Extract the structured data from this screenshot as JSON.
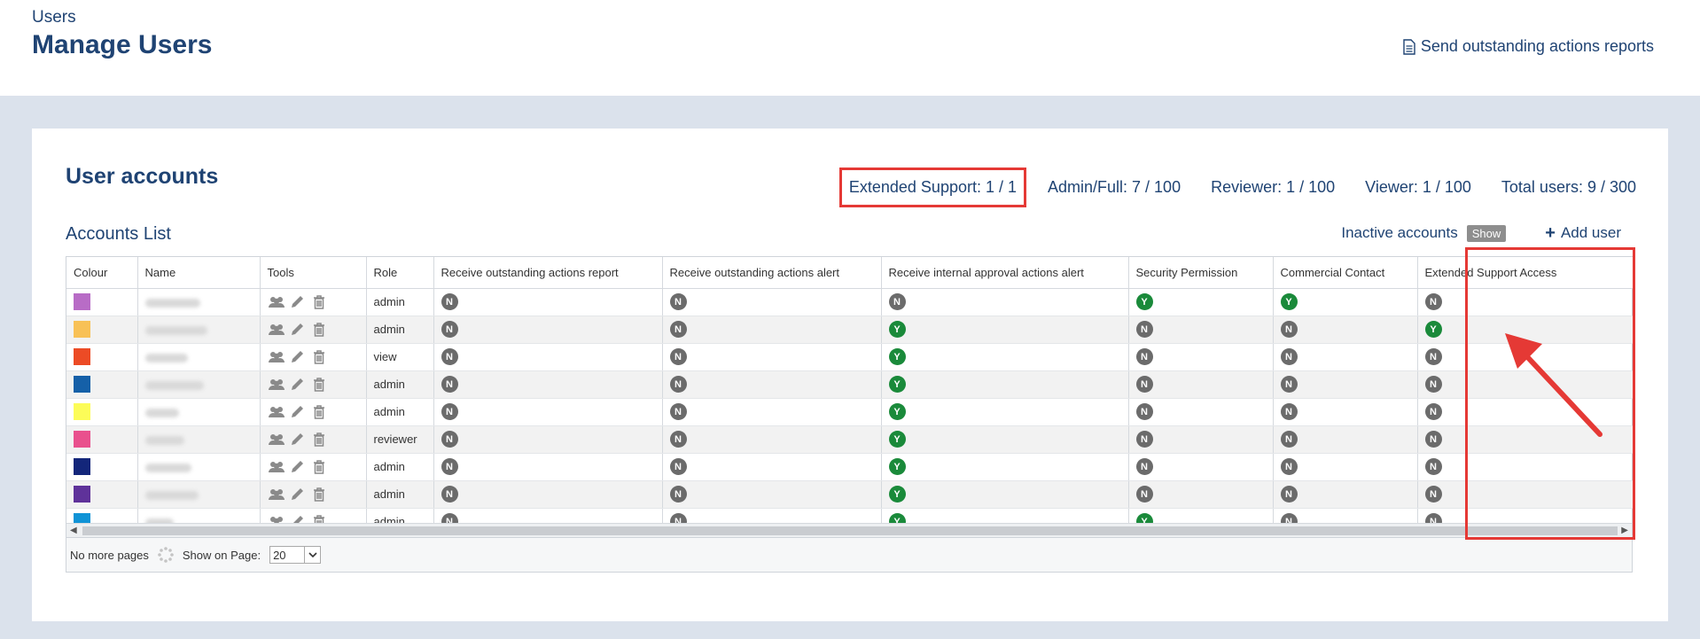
{
  "header": {
    "breadcrumb": "Users",
    "title": "Manage Users",
    "report_link": "Send outstanding actions reports"
  },
  "accounts": {
    "title": "User accounts",
    "stats": {
      "extended_support": "Extended Support: 1 / 1",
      "admin_full": "Admin/Full: 7 / 100",
      "reviewer": "Reviewer: 1 / 100",
      "viewer": "Viewer: 1 / 100",
      "total": "Total users: 9 / 300"
    }
  },
  "list": {
    "title": "Accounts List",
    "inactive_label": "Inactive accounts",
    "show_label": "Show",
    "add_user_label": "Add user"
  },
  "table": {
    "columns": [
      "Colour",
      "Name",
      "Tools",
      "Role",
      "Receive outstanding actions report",
      "Receive outstanding actions alert",
      "Receive internal approval actions alert",
      "Security Permission",
      "Commercial Contact",
      "Extended Support Access"
    ],
    "rows": [
      {
        "colour": "#b86cc6",
        "role": "admin",
        "flags": [
          "N",
          "N",
          "N",
          "Y",
          "Y",
          "N"
        ]
      },
      {
        "colour": "#f8c156",
        "role": "admin",
        "flags": [
          "N",
          "N",
          "Y",
          "N",
          "N",
          "Y"
        ]
      },
      {
        "colour": "#ec4b25",
        "role": "view",
        "flags": [
          "N",
          "N",
          "Y",
          "N",
          "N",
          "N"
        ]
      },
      {
        "colour": "#1560a8",
        "role": "admin",
        "flags": [
          "N",
          "N",
          "Y",
          "N",
          "N",
          "N"
        ]
      },
      {
        "colour": "#fcfc58",
        "role": "admin",
        "flags": [
          "N",
          "N",
          "Y",
          "N",
          "N",
          "N"
        ]
      },
      {
        "colour": "#e9508d",
        "role": "reviewer",
        "flags": [
          "N",
          "N",
          "Y",
          "N",
          "N",
          "N"
        ]
      },
      {
        "colour": "#13267a",
        "role": "admin",
        "flags": [
          "N",
          "N",
          "Y",
          "N",
          "N",
          "N"
        ]
      },
      {
        "colour": "#5f329a",
        "role": "admin",
        "flags": [
          "N",
          "N",
          "Y",
          "N",
          "N",
          "N"
        ]
      },
      {
        "colour": "#0f93d6",
        "role": "admin",
        "flags": [
          "N",
          "N",
          "Y",
          "Y",
          "N",
          "N"
        ]
      }
    ]
  },
  "footer": {
    "pages_label": "No more pages",
    "show_on_page_label": "Show on Page:",
    "page_size": "20"
  },
  "colors": {
    "accent": "#1f4373",
    "flag_yes": "#1a8a3a",
    "flag_no": "#6b6b6b",
    "annotation": "#e53935"
  }
}
